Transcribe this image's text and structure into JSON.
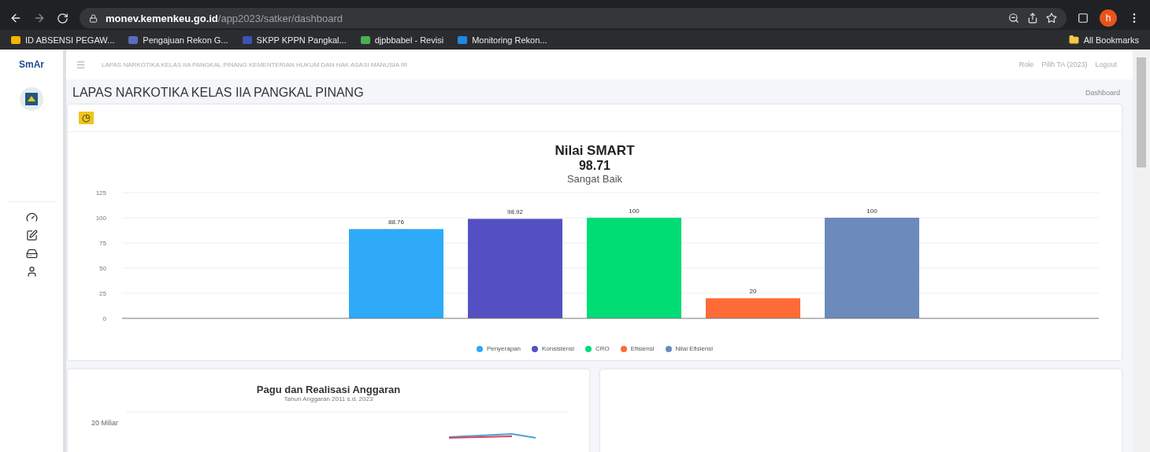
{
  "browser": {
    "url_host": "monev.kemenkeu.go.id",
    "url_path": "/app2023/satker/dashboard",
    "profile_initial": "h",
    "bookmarks": [
      {
        "label": "ID ABSENSI PEGAW...",
        "color": "#f4b400"
      },
      {
        "label": "Pengajuan Rekon G...",
        "color": "#5c6bc0"
      },
      {
        "label": "SKPP KPPN Pangkal...",
        "color": "#3f51b5"
      },
      {
        "label": "djpbbabel - Revisi",
        "color": "#4caf50"
      },
      {
        "label": "Monitoring Rekon...",
        "color": "#1e88e5"
      }
    ],
    "all_bookmarks": "All Bookmarks"
  },
  "app": {
    "logo": "SmAr",
    "header_title": "LAPAS NARKOTIKA KELAS IIA PANGKAL PINANG KEMENTERIAN HUKUM DAN HAK ASASI MANUSIA RI",
    "header_links": [
      "Role",
      "Pilih TA (2023)",
      "Logout"
    ],
    "sidebar": {
      "items": [
        {
          "kind": "gauge"
        },
        {
          "kind": "edit"
        },
        {
          "kind": "drive"
        },
        {
          "kind": "user"
        }
      ]
    },
    "page_title": "LAPAS NARKOTIKA KELAS IIA PANGKAL PINANG",
    "breadcrumb": "Dashboard"
  },
  "smart_card": {
    "title": "Nilai SMART",
    "score": "98.71",
    "rating": "Sangat Baik",
    "chart_data": {
      "type": "bar",
      "grid": true,
      "ylim": [
        0,
        125
      ],
      "yticks": [
        0,
        25,
        50,
        75,
        100,
        125
      ],
      "data_labels": true,
      "series": [
        {
          "name": "Penyerapan",
          "color": "#2eaaf8",
          "values": [
            88.76
          ]
        },
        {
          "name": "Konsistensi",
          "color": "#5450c4",
          "values": [
            98.92
          ]
        },
        {
          "name": "CRO",
          "color": "#00dd74",
          "values": [
            100
          ]
        },
        {
          "name": "Efisiensi",
          "color": "#fe6b36",
          "values": [
            20
          ]
        },
        {
          "name": "Nilai Efisiensi",
          "color": "#6c8abb",
          "values": [
            100
          ]
        }
      ]
    }
  },
  "budget_card": {
    "title": "Pagu dan Realisasi Anggaran",
    "subtitle": "Tahun Anggaran 2011 s.d. 2023",
    "y_label": "20 Miliar"
  }
}
